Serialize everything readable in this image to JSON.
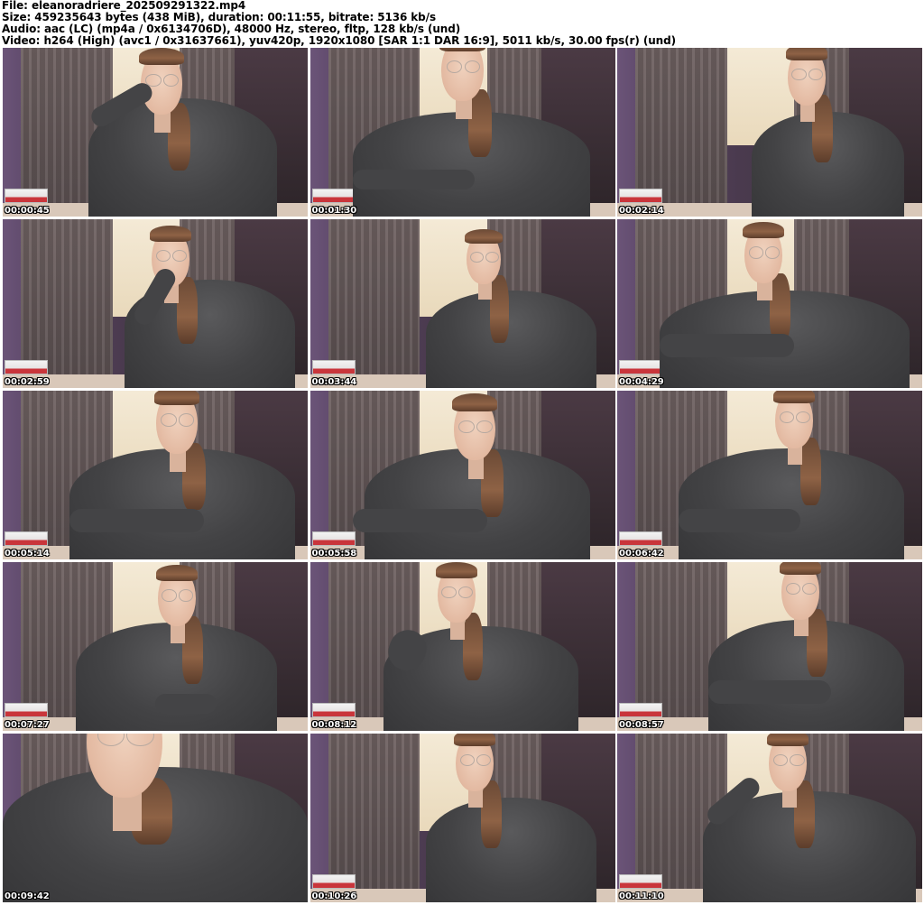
{
  "header": {
    "file_line": "File: eleanoradriere_202509291322.mp4",
    "size_line": "Size: 459235643 bytes (438 MiB), duration: 00:11:55, bitrate: 5136 kb/s",
    "audio_line": "Audio: aac (LC) (mp4a / 0x6134706D), 48000 Hz, stereo, fltp, 128 kb/s (und)",
    "video_line": "Video: h264 (High) (avc1 / 0x31637661), yuv420p, 1920x1080 [SAR 1:1 DAR 16:9], 5011 kb/s, 30.00 fps(r) (und)"
  },
  "grid": {
    "columns": 3,
    "rows": 5,
    "thumbnails": [
      {
        "timestamp": "00:00:45"
      },
      {
        "timestamp": "00:01:30"
      },
      {
        "timestamp": "00:02:14"
      },
      {
        "timestamp": "00:02:59"
      },
      {
        "timestamp": "00:03:44"
      },
      {
        "timestamp": "00:04:29"
      },
      {
        "timestamp": "00:05:14"
      },
      {
        "timestamp": "00:05:58"
      },
      {
        "timestamp": "00:06:42"
      },
      {
        "timestamp": "00:07:27"
      },
      {
        "timestamp": "00:08:12"
      },
      {
        "timestamp": "00:08:57"
      },
      {
        "timestamp": "00:09:42"
      },
      {
        "timestamp": "00:10:26"
      },
      {
        "timestamp": "00:11:10"
      }
    ]
  },
  "colors": {
    "background": "#ffffff",
    "header_text": "#000000",
    "timestamp_text": "#ffffff",
    "sweater": "#434345",
    "wall": "#5a4566",
    "curtain": "#6f6262",
    "window_light": "#f4ead6"
  }
}
